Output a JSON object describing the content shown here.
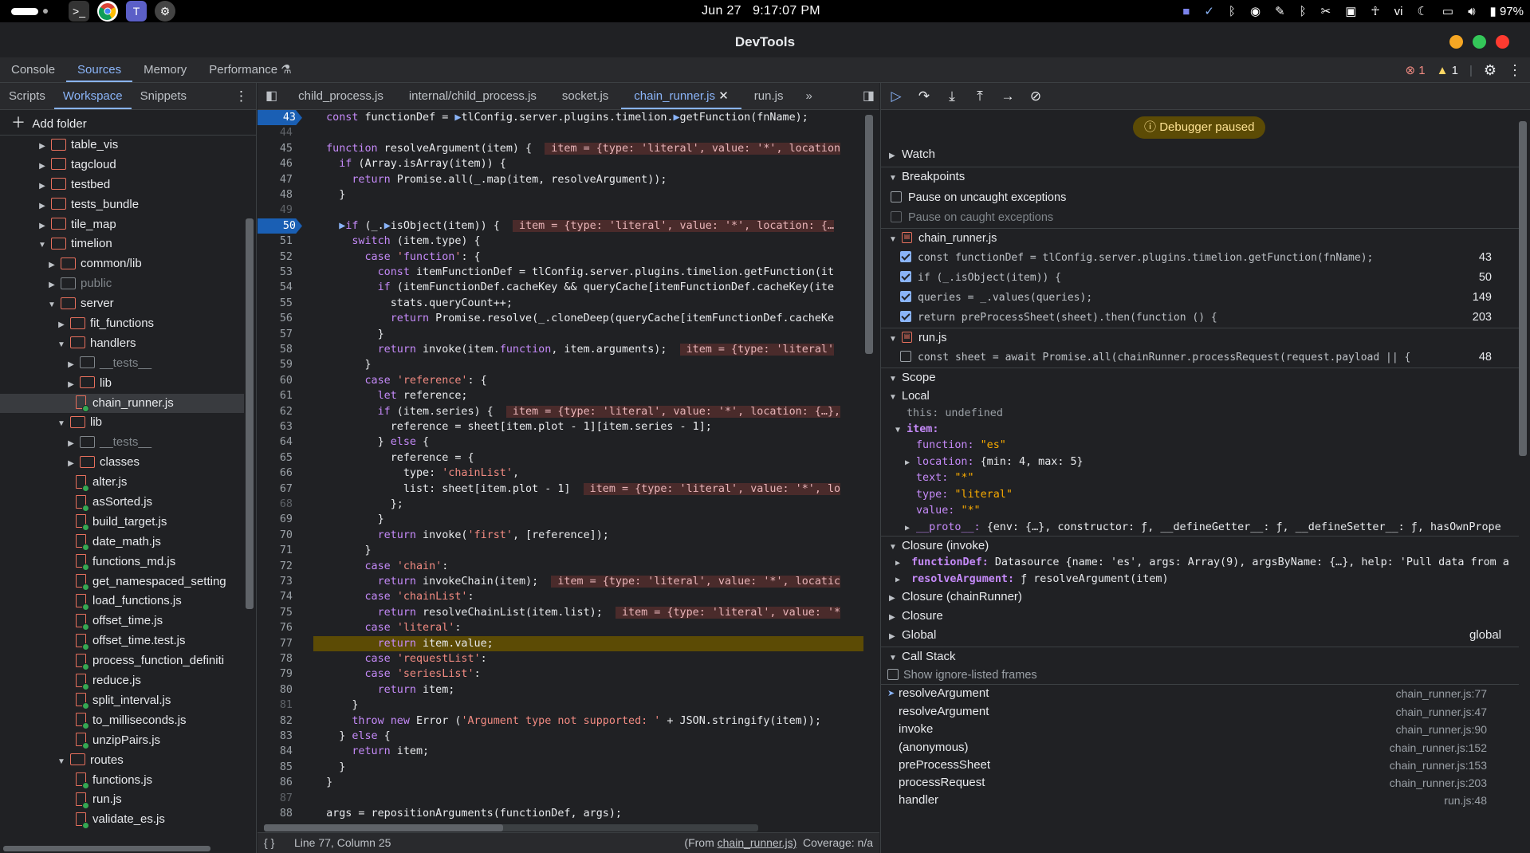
{
  "system": {
    "date": "Jun 27",
    "time": "9:17:07 PM",
    "keyboard": "vi",
    "battery": "97%"
  },
  "window": {
    "title": "DevTools"
  },
  "main_tabs": [
    "Console",
    "Sources",
    "Memory",
    "Performance"
  ],
  "errors": {
    "error_count": "1",
    "warning_count": "1"
  },
  "navigator": {
    "tabs": [
      "Scripts",
      "Workspace",
      "Snippets"
    ],
    "add_folder": "Add folder",
    "tree": [
      {
        "label": "table_vis",
        "type": "folder",
        "depth": 2,
        "arrow": "▶"
      },
      {
        "label": "tagcloud",
        "type": "folder",
        "depth": 2,
        "arrow": "▶"
      },
      {
        "label": "testbed",
        "type": "folder",
        "depth": 2,
        "arrow": "▶"
      },
      {
        "label": "tests_bundle",
        "type": "folder",
        "depth": 2,
        "arrow": "▶"
      },
      {
        "label": "tile_map",
        "type": "folder",
        "depth": 2,
        "arrow": "▶"
      },
      {
        "label": "timelion",
        "type": "folder",
        "depth": 2,
        "arrow": "▼"
      },
      {
        "label": "common/lib",
        "type": "folder",
        "depth": 3,
        "arrow": "▶"
      },
      {
        "label": "public",
        "type": "folder",
        "depth": 3,
        "arrow": "▶",
        "dim": true
      },
      {
        "label": "server",
        "type": "folder",
        "depth": 3,
        "arrow": "▼"
      },
      {
        "label": "fit_functions",
        "type": "folder",
        "depth": 4,
        "arrow": "▶"
      },
      {
        "label": "handlers",
        "type": "folder",
        "depth": 4,
        "arrow": "▼"
      },
      {
        "label": "__tests__",
        "type": "folder",
        "depth": 5,
        "arrow": "▶",
        "dim": true
      },
      {
        "label": "lib",
        "type": "folder",
        "depth": 5,
        "arrow": "▶"
      },
      {
        "label": "chain_runner.js",
        "type": "file",
        "depth": 5,
        "selected": true
      },
      {
        "label": "lib",
        "type": "folder",
        "depth": 4,
        "arrow": "▼"
      },
      {
        "label": "__tests__",
        "type": "folder",
        "depth": 5,
        "arrow": "▶",
        "dim": true
      },
      {
        "label": "classes",
        "type": "folder",
        "depth": 5,
        "arrow": "▶"
      },
      {
        "label": "alter.js",
        "type": "file",
        "depth": 5
      },
      {
        "label": "asSorted.js",
        "type": "file",
        "depth": 5
      },
      {
        "label": "build_target.js",
        "type": "file",
        "depth": 5
      },
      {
        "label": "date_math.js",
        "type": "file",
        "depth": 5
      },
      {
        "label": "functions_md.js",
        "type": "file",
        "depth": 5
      },
      {
        "label": "get_namespaced_setting",
        "type": "file",
        "depth": 5
      },
      {
        "label": "load_functions.js",
        "type": "file",
        "depth": 5
      },
      {
        "label": "offset_time.js",
        "type": "file",
        "depth": 5
      },
      {
        "label": "offset_time.test.js",
        "type": "file",
        "depth": 5
      },
      {
        "label": "process_function_definiti",
        "type": "file",
        "depth": 5
      },
      {
        "label": "reduce.js",
        "type": "file",
        "depth": 5
      },
      {
        "label": "split_interval.js",
        "type": "file",
        "depth": 5
      },
      {
        "label": "to_milliseconds.js",
        "type": "file",
        "depth": 5
      },
      {
        "label": "unzipPairs.js",
        "type": "file",
        "depth": 5
      },
      {
        "label": "routes",
        "type": "folder",
        "depth": 4,
        "arrow": "▼"
      },
      {
        "label": "functions.js",
        "type": "file",
        "depth": 5
      },
      {
        "label": "run.js",
        "type": "file",
        "depth": 5
      },
      {
        "label": "validate_es.js",
        "type": "file",
        "depth": 5
      }
    ]
  },
  "editor": {
    "tabs": [
      "child_process.js",
      "internal/child_process.js",
      "socket.js",
      "chain_runner.js",
      "run.js"
    ],
    "active_tab": "chain_runner.js",
    "lines": [
      {
        "n": "43",
        "bp": true,
        "code": "  const functionDef = ▶tlConfig.server.plugins.timelion.▶getFunction(fnName);"
      },
      {
        "n": "44",
        "blank": true,
        "code": ""
      },
      {
        "n": "45",
        "code": "  function resolveArgument(item) {",
        "inline": "item = {type: 'literal', value: '*', location"
      },
      {
        "n": "46",
        "code": "    if (Array.isArray(item)) {"
      },
      {
        "n": "47",
        "code": "      return Promise.all(_.map(item, resolveArgument));"
      },
      {
        "n": "48",
        "code": "    }"
      },
      {
        "n": "49",
        "blank": true,
        "code": ""
      },
      {
        "n": "50",
        "bp": true,
        "code": "    ▶if (_.▶isObject(item)) {",
        "inline": "item = {type: 'literal', value: '*', location: {…"
      },
      {
        "n": "51",
        "code": "      switch (item.type) {"
      },
      {
        "n": "52",
        "code": "        case 'function': {"
      },
      {
        "n": "53",
        "code": "          const itemFunctionDef = tlConfig.server.plugins.timelion.getFunction(it"
      },
      {
        "n": "54",
        "code": "          if (itemFunctionDef.cacheKey && queryCache[itemFunctionDef.cacheKey(ite"
      },
      {
        "n": "55",
        "code": "            stats.queryCount++;"
      },
      {
        "n": "56",
        "code": "            return Promise.resolve(_.cloneDeep(queryCache[itemFunctionDef.cacheKe"
      },
      {
        "n": "57",
        "code": "          }"
      },
      {
        "n": "58",
        "code": "          return invoke(item.function, item.arguments);",
        "inline": "item = {type: 'literal'"
      },
      {
        "n": "59",
        "code": "        }"
      },
      {
        "n": "60",
        "code": "        case 'reference': {"
      },
      {
        "n": "61",
        "code": "          let reference;"
      },
      {
        "n": "62",
        "code": "          if (item.series) {",
        "inline": "item = {type: 'literal', value: '*', location: {…},"
      },
      {
        "n": "63",
        "code": "            reference = sheet[item.plot - 1][item.series - 1];"
      },
      {
        "n": "64",
        "code": "          } else {"
      },
      {
        "n": "65",
        "code": "            reference = {"
      },
      {
        "n": "66",
        "code": "              type: 'chainList',"
      },
      {
        "n": "67",
        "code": "              list: sheet[item.plot - 1]",
        "inline": "item = {type: 'literal', value: '*', lo"
      },
      {
        "n": "68",
        "blank": true,
        "code": "            };"
      },
      {
        "n": "69",
        "code": "          }"
      },
      {
        "n": "70",
        "code": "          return invoke('first', [reference]);"
      },
      {
        "n": "71",
        "code": "        }"
      },
      {
        "n": "72",
        "code": "        case 'chain':"
      },
      {
        "n": "73",
        "code": "          return invokeChain(item);",
        "inline": "item = {type: 'literal', value: '*', locatic"
      },
      {
        "n": "74",
        "code": "        case 'chainList':"
      },
      {
        "n": "75",
        "code": "          return resolveChainList(item.list);",
        "inline": "item = {type: 'literal', value: '*"
      },
      {
        "n": "76",
        "code": "        case 'literal':"
      },
      {
        "n": "77",
        "exec": true,
        "code": "          return item.value;"
      },
      {
        "n": "78",
        "code": "        case 'requestList':"
      },
      {
        "n": "79",
        "code": "        case 'seriesList':"
      },
      {
        "n": "80",
        "code": "          return item;"
      },
      {
        "n": "81",
        "blank": true,
        "code": "      }"
      },
      {
        "n": "82",
        "code": "      throw new Error ('Argument type not supported: ' + JSON.stringify(item));"
      },
      {
        "n": "83",
        "code": "    } else {"
      },
      {
        "n": "84",
        "code": "      return item;"
      },
      {
        "n": "85",
        "code": "    }"
      },
      {
        "n": "86",
        "code": "  }"
      },
      {
        "n": "87",
        "blank": true,
        "code": ""
      },
      {
        "n": "88",
        "code": "  args = repositionArguments(functionDef, args);"
      }
    ],
    "status": {
      "position": "Line 77, Column 25",
      "from_prefix": "(From ",
      "from_file": "chain_runner.js)",
      "coverage": "Coverage: n/a"
    }
  },
  "debugger": {
    "paused_label": "Debugger paused",
    "watch": "Watch",
    "breakpoints_title": "Breakpoints",
    "pause_uncaught": "Pause on uncaught exceptions",
    "pause_caught": "Pause on caught exceptions",
    "bp_files": [
      {
        "file": "chain_runner.js",
        "items": [
          {
            "code": "const functionDef = tlConfig.server.plugins.timelion.getFunction(fnName);",
            "line": "43",
            "checked": true
          },
          {
            "code": "if (_.isObject(item)) {",
            "line": "50",
            "checked": true
          },
          {
            "code": "queries = _.values(queries);",
            "line": "149",
            "checked": true
          },
          {
            "code": "return preProcessSheet(sheet).then(function () {",
            "line": "203",
            "checked": true
          }
        ]
      },
      {
        "file": "run.js",
        "items": [
          {
            "code": "const sheet = await Promise.all(chainRunner.processRequest(request.payload || {",
            "line": "48",
            "checked": false
          }
        ]
      }
    ],
    "scope_title": "Scope",
    "local_title": "Local",
    "this_key": "this:",
    "this_val": "undefined",
    "item_key": "item:",
    "item_props": [
      {
        "k": "function:",
        "v": "\"es\"",
        "kind": "strv"
      },
      {
        "k": "location:",
        "v": "{min: 4, max: 5}",
        "kind": "obj",
        "arrow": true
      },
      {
        "k": "text:",
        "v": "\"*\"",
        "kind": "strv"
      },
      {
        "k": "type:",
        "v": "\"literal\"",
        "kind": "strv"
      },
      {
        "k": "value:",
        "v": "\"*\"",
        "kind": "strv"
      },
      {
        "k": "__proto__:",
        "v": "{env: {…}, constructor: ƒ, __defineGetter__: ƒ, __defineSetter__: ƒ, hasOwnPrope",
        "kind": "obj",
        "arrow": true
      }
    ],
    "closure_invoke": "Closure (invoke)",
    "closure_items": [
      {
        "k": "functionDef:",
        "v": "Datasource {name: 'es', args: Array(9), argsByName: {…}, help: 'Pull data from a"
      },
      {
        "k": "resolveArgument:",
        "v": "ƒ resolveArgument(item)"
      }
    ],
    "closure_chain": "Closure (chainRunner)",
    "closure": "Closure",
    "global": "Global",
    "global_val": "global",
    "callstack_title": "Call Stack",
    "show_ignore": "Show ignore-listed frames",
    "frames": [
      {
        "name": "resolveArgument",
        "loc": "chain_runner.js:77",
        "current": true
      },
      {
        "name": "resolveArgument",
        "loc": "chain_runner.js:47"
      },
      {
        "name": "invoke",
        "loc": "chain_runner.js:90"
      },
      {
        "name": "(anonymous)",
        "loc": "chain_runner.js:152"
      },
      {
        "name": "preProcessSheet",
        "loc": "chain_runner.js:153"
      },
      {
        "name": "processRequest",
        "loc": "chain_runner.js:203"
      },
      {
        "name": "handler",
        "loc": "run.js:48"
      }
    ]
  },
  "colors": {
    "accent": "#8ab4f8",
    "breakpoint": "#1a5fb4",
    "exec_line": "#5c4b05",
    "folder_icon": "#e8705d",
    "error": "#f28b82",
    "warning": "#fdd663"
  }
}
